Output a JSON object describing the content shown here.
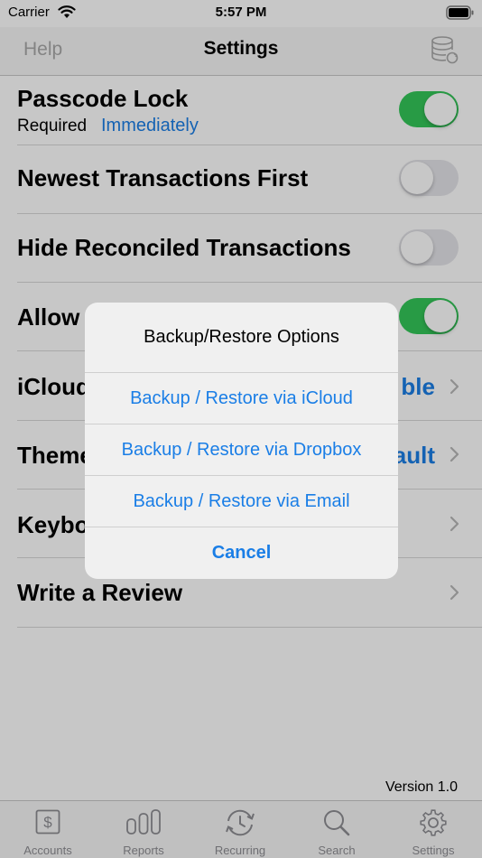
{
  "status_bar": {
    "carrier": "Carrier",
    "time": "5:57 PM"
  },
  "nav": {
    "left": "Help",
    "title": "Settings",
    "right_icon": "database-sync-icon"
  },
  "settings": {
    "passcode": {
      "label": "Passcode Lock",
      "sub_label": "Required",
      "sub_value": "Immediately",
      "on": true
    },
    "newest_first": {
      "label": "Newest Transactions First",
      "on": false
    },
    "hide_reconciled": {
      "label": "Hide Reconciled Transactions",
      "on": false
    },
    "allow": {
      "label": "Allow",
      "on": true
    },
    "icloud": {
      "label": "iCloud",
      "value": "ble"
    },
    "theme": {
      "label": "Theme",
      "value": "ault"
    },
    "keyboard": {
      "label": "Keybo"
    },
    "review": {
      "label": "Write a Review"
    }
  },
  "version": "Version 1.0",
  "tabs": [
    {
      "label": "Accounts",
      "icon": "dollar-icon"
    },
    {
      "label": "Reports",
      "icon": "bar-chart-icon"
    },
    {
      "label": "Recurring",
      "icon": "recurring-icon"
    },
    {
      "label": "Search",
      "icon": "search-icon"
    },
    {
      "label": "Settings",
      "icon": "gear-icon"
    }
  ],
  "alert": {
    "title": "Backup/Restore Options",
    "options": [
      "Backup / Restore via iCloud",
      "Backup / Restore via Dropbox",
      "Backup / Restore via Email"
    ],
    "cancel": "Cancel"
  },
  "colors": {
    "accent": "#1a7ee6",
    "toggle_on": "#34c759",
    "toggle_off": "#e5e5ea"
  }
}
